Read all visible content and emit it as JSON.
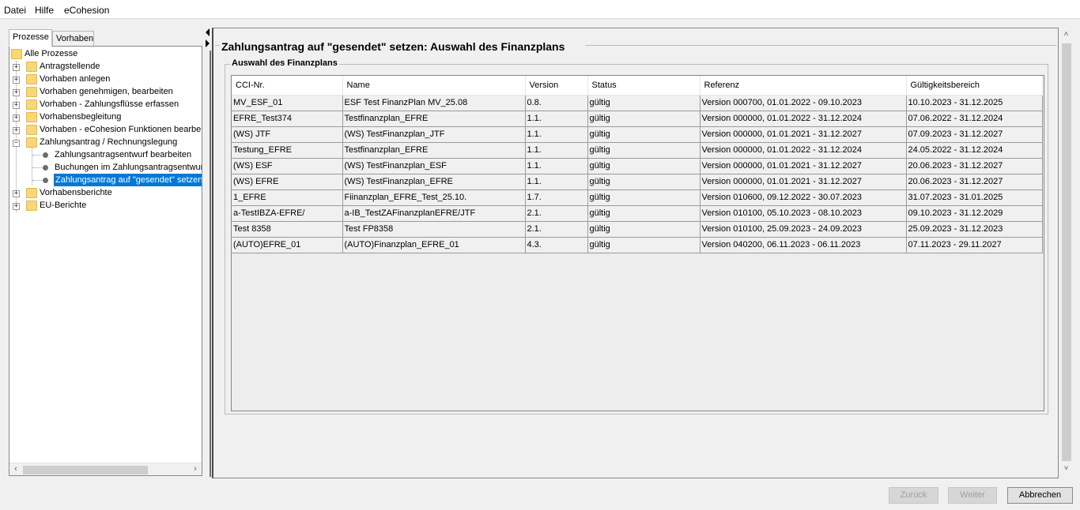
{
  "menu": {
    "datei": "Datei",
    "hilfe": "Hilfe",
    "ecohesion": "eCohesion"
  },
  "tabs": {
    "prozesse": "Prozesse",
    "vorhaben": "Vorhaben"
  },
  "tree": {
    "root": "Alle Prozesse",
    "items": [
      "Antragstellende",
      "Vorhaben anlegen",
      "Vorhaben genehmigen, bearbeiten",
      "Vorhaben - Zahlungsflüsse erfassen",
      "Vorhabensbegleitung",
      "Vorhaben - eCohesion Funktionen bearbeiten",
      "Zahlungsantrag / Rechnungslegung",
      "Zahlungsantragsentwurf bearbeiten",
      "Buchungen im Zahlungsantragsentwurf",
      "Zahlungsantrag auf \"gesendet\" setzen",
      "Vorhabensberichte",
      "EU-Berichte"
    ]
  },
  "main": {
    "title": "Zahlungsantrag auf \"gesendet\" setzen: Auswahl des Finanzplans",
    "group_title": "Auswahl des Finanzplans"
  },
  "table": {
    "headers": [
      "CCI-Nr.",
      "Name",
      "Version",
      "Status",
      "Referenz",
      "Gültigkeitsbereich"
    ],
    "rows": [
      [
        "MV_ESF_01",
        "ESF Test FinanzPlan MV_25.08",
        "0.8.",
        "gültig",
        "Version 000700,  01.01.2022 - 09.10.2023",
        "10.10.2023 - 31.12.2025"
      ],
      [
        "EFRE_Test374",
        "Testfinanzplan_EFRE",
        "1.1.",
        "gültig",
        "Version 000000,  01.01.2022 - 31.12.2024",
        "07.06.2022 - 31.12.2024"
      ],
      [
        "(WS) JTF",
        "(WS) TestFinanzplan_JTF",
        "1.1.",
        "gültig",
        "Version 000000,  01.01.2021 - 31.12.2027",
        "07.09.2023 - 31.12.2027"
      ],
      [
        "Testung_EFRE",
        "Testfinanzplan_EFRE",
        "1.1.",
        "gültig",
        "Version 000000,  01.01.2022 - 31.12.2024",
        "24.05.2022 - 31.12.2024"
      ],
      [
        "(WS) ESF",
        "(WS) TestFinanzplan_ESF",
        "1.1.",
        "gültig",
        "Version 000000,  01.01.2021 - 31.12.2027",
        "20.06.2023 - 31.12.2027"
      ],
      [
        "(WS) EFRE",
        "(WS) TestFinanzplan_EFRE",
        "1.1.",
        "gültig",
        "Version 000000,  01.01.2021 - 31.12.2027",
        "20.06.2023 - 31.12.2027"
      ],
      [
        "1_EFRE",
        "Fiinanzplan_EFRE_Test_25.10.",
        "1.7.",
        "gültig",
        "Version 010600,  09.12.2022 - 30.07.2023",
        "31.07.2023 - 31.01.2025"
      ],
      [
        "a-TestIBZA-EFRE/",
        "a-IB_TestZAFinanzplanEFRE/JTF",
        "2.1.",
        "gültig",
        "Version 010100,  05.10.2023 - 08.10.2023",
        "09.10.2023 - 31.12.2029"
      ],
      [
        "Test 8358",
        "Test FP8358",
        "2.1.",
        "gültig",
        "Version 010100,  25.09.2023 - 24.09.2023",
        "25.09.2023 - 31.12.2023"
      ],
      [
        "(AUTO)EFRE_01",
        "(AUTO)Finanzplan_EFRE_01",
        "4.3.",
        "gültig",
        "Version 040200,  06.11.2023 - 06.11.2023",
        "07.11.2023 - 29.11.2027"
      ]
    ]
  },
  "buttons": {
    "zurueck": "Zurück",
    "weiter": "Weiter",
    "abbrechen": "Abbrechen"
  }
}
